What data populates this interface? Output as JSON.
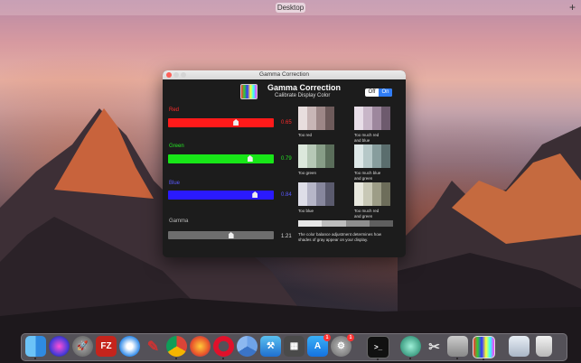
{
  "topbar": {
    "desktop_label": "Desktop",
    "add_label": "+"
  },
  "window": {
    "title": "Gamma Correction",
    "app_title": "Gamma Correction",
    "app_subtitle": "Calibrate Display Color",
    "toggle": {
      "off_label": "Off",
      "on_label": "On",
      "state": "On"
    }
  },
  "sliders": {
    "red": {
      "label": "Red",
      "value": "0.65",
      "fraction": 0.65,
      "color": "#ff1a1a"
    },
    "green": {
      "label": "Green",
      "value": "0.79",
      "fraction": 0.79,
      "color": "#18e618"
    },
    "blue": {
      "label": "Blue",
      "value": "0.84",
      "fraction": 0.84,
      "color": "#2a1aff"
    },
    "gamma": {
      "label": "Gamma",
      "value": "1.21",
      "fraction": 0.6,
      "color": "#777777"
    }
  },
  "swatches": {
    "too_red": "Too red",
    "too_much_red_blue_1": "Too much red",
    "too_much_red_blue_2": "and blue",
    "too_green": "Too green",
    "too_much_blue_green_1": "Too much blue",
    "too_much_blue_green_2": "and green",
    "too_blue": "Too blue",
    "too_much_red_green_1": "Too much red",
    "too_much_red_green_2": "and green"
  },
  "note": "The color balance adjustment determines how shades of gray appear on your display.",
  "dock": {
    "icons": [
      "finder-icon",
      "siri-icon",
      "launchpad-icon",
      "filezilla-icon",
      "safari-icon",
      "scrobbles-icon",
      "chrome-icon",
      "firefox-icon",
      "opera-icon",
      "chromium-icon",
      "xcode-icon",
      "calculator-icon",
      "app-store-icon",
      "system-preferences-icon",
      "terminal-icon",
      "cleanmaster-icon",
      "utilities-icon",
      "preview-icon",
      "gamma-correction-icon",
      "downloads-icon",
      "trash-icon"
    ],
    "filezilla_text": "FZ",
    "badge_app_store": "1",
    "badge_sys_prefs": "1",
    "terminal_text": ">_"
  }
}
